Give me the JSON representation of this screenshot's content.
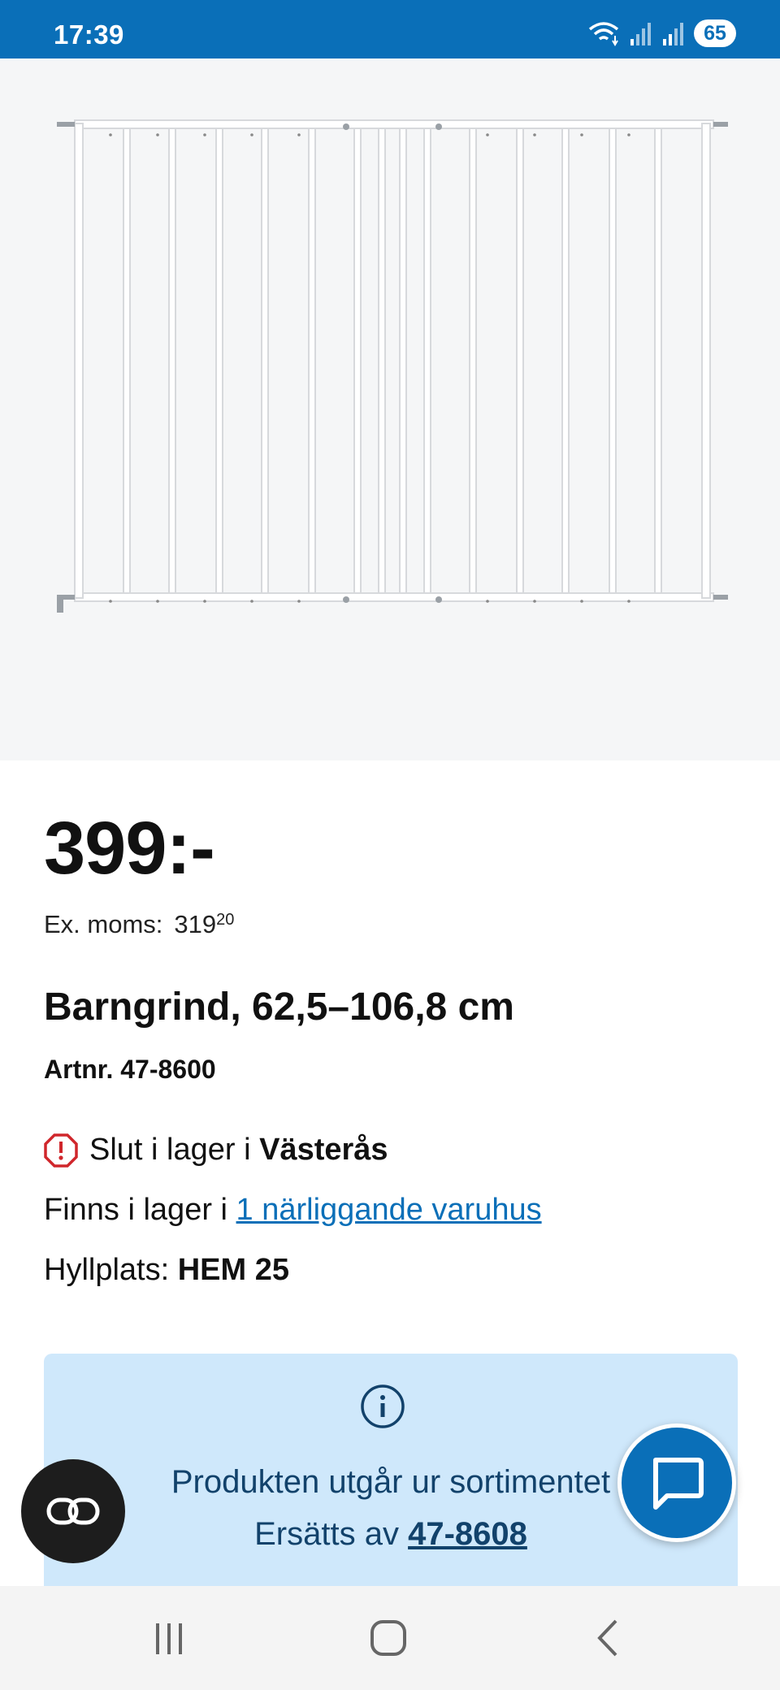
{
  "status_bar": {
    "time": "17:39",
    "battery": "65",
    "icons": [
      "wifi-icon",
      "signal-icon",
      "signal-icon",
      "battery-icon"
    ]
  },
  "product": {
    "image_alt": "barngrind product image",
    "price": "399:-",
    "ex_moms_label": "Ex. moms:",
    "ex_moms_value": "319",
    "ex_moms_decimals": "20",
    "title": "Barngrind, 62,5–106,8 cm",
    "artnr": "Artnr. 47-8600"
  },
  "stock": {
    "out_of_stock_prefix": "Slut i lager i ",
    "out_of_stock_store": "Västerås",
    "available_prefix": "Finns i lager i ",
    "available_link": "1 närliggande varuhus",
    "shelf_label": "Hyllplats: ",
    "shelf_value": "HEM 25"
  },
  "notice": {
    "line1": "Produkten utgår ur sortimentet",
    "line2_prefix": "Ersätts av ",
    "line2_link": "47-8608"
  },
  "colors": {
    "brand_blue": "#0a6fb8",
    "notice_bg": "#cfe8fb",
    "notice_text": "#12426b",
    "warning_red": "#d0262b"
  }
}
